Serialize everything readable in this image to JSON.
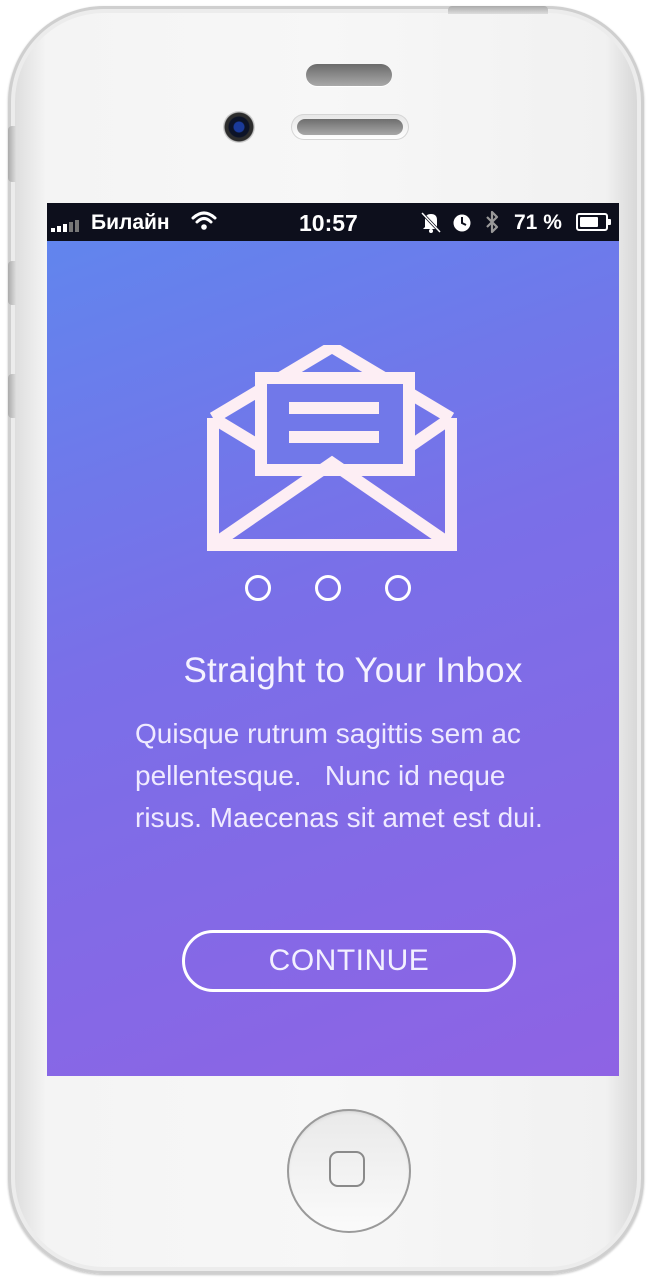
{
  "status_bar": {
    "carrier": "Билайн",
    "time": "10:57",
    "battery_percent": "71 %",
    "icons": [
      "signal-icon",
      "wifi-icon",
      "mute-bell-icon",
      "alarm-clock-icon",
      "bluetooth-icon",
      "battery-icon"
    ]
  },
  "onboarding": {
    "illustration_icon": "open-envelope-icon",
    "page_indicator": {
      "count": 3,
      "active_index": null
    },
    "title": "Straight to Your Inbox",
    "body_lines": [
      "Quisque rutrum sagittis sem ac",
      "pellentesque.   Nunc id neque",
      "risus. Maecenas sit amet est dui."
    ],
    "continue_label": "CONTINUE"
  },
  "colors": {
    "gradient_start": "#5f87ee",
    "gradient_end": "#8e63e4",
    "foreground": "#ffffff",
    "status_bar_bg": "#0d0f1c"
  }
}
